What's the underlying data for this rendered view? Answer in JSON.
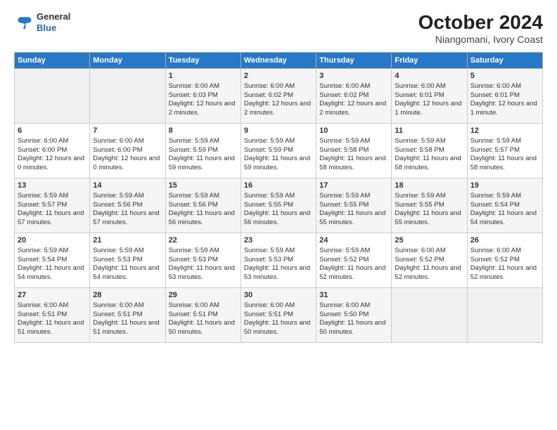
{
  "header": {
    "logo_line1": "General",
    "logo_line2": "Blue",
    "title": "October 2024",
    "subtitle": "Niangomani, Ivory Coast"
  },
  "days_of_week": [
    "Sunday",
    "Monday",
    "Tuesday",
    "Wednesday",
    "Thursday",
    "Friday",
    "Saturday"
  ],
  "weeks": [
    [
      {
        "day": "",
        "sunrise": "",
        "sunset": "",
        "daylight": ""
      },
      {
        "day": "",
        "sunrise": "",
        "sunset": "",
        "daylight": ""
      },
      {
        "day": "1",
        "sunrise": "Sunrise: 6:00 AM",
        "sunset": "Sunset: 6:03 PM",
        "daylight": "Daylight: 12 hours and 2 minutes."
      },
      {
        "day": "2",
        "sunrise": "Sunrise: 6:00 AM",
        "sunset": "Sunset: 6:02 PM",
        "daylight": "Daylight: 12 hours and 2 minutes."
      },
      {
        "day": "3",
        "sunrise": "Sunrise: 6:00 AM",
        "sunset": "Sunset: 6:02 PM",
        "daylight": "Daylight: 12 hours and 2 minutes."
      },
      {
        "day": "4",
        "sunrise": "Sunrise: 6:00 AM",
        "sunset": "Sunset: 6:01 PM",
        "daylight": "Daylight: 12 hours and 1 minute."
      },
      {
        "day": "5",
        "sunrise": "Sunrise: 6:00 AM",
        "sunset": "Sunset: 6:01 PM",
        "daylight": "Daylight: 12 hours and 1 minute."
      }
    ],
    [
      {
        "day": "6",
        "sunrise": "Sunrise: 6:00 AM",
        "sunset": "Sunset: 6:00 PM",
        "daylight": "Daylight: 12 hours and 0 minutes."
      },
      {
        "day": "7",
        "sunrise": "Sunrise: 6:00 AM",
        "sunset": "Sunset: 6:00 PM",
        "daylight": "Daylight: 12 hours and 0 minutes."
      },
      {
        "day": "8",
        "sunrise": "Sunrise: 5:59 AM",
        "sunset": "Sunset: 5:59 PM",
        "daylight": "Daylight: 11 hours and 59 minutes."
      },
      {
        "day": "9",
        "sunrise": "Sunrise: 5:59 AM",
        "sunset": "Sunset: 5:59 PM",
        "daylight": "Daylight: 11 hours and 59 minutes."
      },
      {
        "day": "10",
        "sunrise": "Sunrise: 5:59 AM",
        "sunset": "Sunset: 5:58 PM",
        "daylight": "Daylight: 11 hours and 58 minutes."
      },
      {
        "day": "11",
        "sunrise": "Sunrise: 5:59 AM",
        "sunset": "Sunset: 5:58 PM",
        "daylight": "Daylight: 11 hours and 58 minutes."
      },
      {
        "day": "12",
        "sunrise": "Sunrise: 5:59 AM",
        "sunset": "Sunset: 5:57 PM",
        "daylight": "Daylight: 11 hours and 58 minutes."
      }
    ],
    [
      {
        "day": "13",
        "sunrise": "Sunrise: 5:59 AM",
        "sunset": "Sunset: 5:57 PM",
        "daylight": "Daylight: 11 hours and 57 minutes."
      },
      {
        "day": "14",
        "sunrise": "Sunrise: 5:59 AM",
        "sunset": "Sunset: 5:56 PM",
        "daylight": "Daylight: 11 hours and 57 minutes."
      },
      {
        "day": "15",
        "sunrise": "Sunrise: 5:59 AM",
        "sunset": "Sunset: 5:56 PM",
        "daylight": "Daylight: 11 hours and 56 minutes."
      },
      {
        "day": "16",
        "sunrise": "Sunrise: 5:59 AM",
        "sunset": "Sunset: 5:55 PM",
        "daylight": "Daylight: 11 hours and 56 minutes."
      },
      {
        "day": "17",
        "sunrise": "Sunrise: 5:59 AM",
        "sunset": "Sunset: 5:55 PM",
        "daylight": "Daylight: 11 hours and 55 minutes."
      },
      {
        "day": "18",
        "sunrise": "Sunrise: 5:59 AM",
        "sunset": "Sunset: 5:55 PM",
        "daylight": "Daylight: 11 hours and 55 minutes."
      },
      {
        "day": "19",
        "sunrise": "Sunrise: 5:59 AM",
        "sunset": "Sunset: 5:54 PM",
        "daylight": "Daylight: 11 hours and 54 minutes."
      }
    ],
    [
      {
        "day": "20",
        "sunrise": "Sunrise: 5:59 AM",
        "sunset": "Sunset: 5:54 PM",
        "daylight": "Daylight: 11 hours and 54 minutes."
      },
      {
        "day": "21",
        "sunrise": "Sunrise: 5:59 AM",
        "sunset": "Sunset: 5:53 PM",
        "daylight": "Daylight: 11 hours and 54 minutes."
      },
      {
        "day": "22",
        "sunrise": "Sunrise: 5:59 AM",
        "sunset": "Sunset: 5:53 PM",
        "daylight": "Daylight: 11 hours and 53 minutes."
      },
      {
        "day": "23",
        "sunrise": "Sunrise: 5:59 AM",
        "sunset": "Sunset: 5:53 PM",
        "daylight": "Daylight: 11 hours and 53 minutes."
      },
      {
        "day": "24",
        "sunrise": "Sunrise: 5:59 AM",
        "sunset": "Sunset: 5:52 PM",
        "daylight": "Daylight: 11 hours and 52 minutes."
      },
      {
        "day": "25",
        "sunrise": "Sunrise: 6:00 AM",
        "sunset": "Sunset: 5:52 PM",
        "daylight": "Daylight: 11 hours and 52 minutes."
      },
      {
        "day": "26",
        "sunrise": "Sunrise: 6:00 AM",
        "sunset": "Sunset: 5:52 PM",
        "daylight": "Daylight: 11 hours and 52 minutes."
      }
    ],
    [
      {
        "day": "27",
        "sunrise": "Sunrise: 6:00 AM",
        "sunset": "Sunset: 5:51 PM",
        "daylight": "Daylight: 11 hours and 51 minutes."
      },
      {
        "day": "28",
        "sunrise": "Sunrise: 6:00 AM",
        "sunset": "Sunset: 5:51 PM",
        "daylight": "Daylight: 11 hours and 51 minutes."
      },
      {
        "day": "29",
        "sunrise": "Sunrise: 6:00 AM",
        "sunset": "Sunset: 5:51 PM",
        "daylight": "Daylight: 11 hours and 50 minutes."
      },
      {
        "day": "30",
        "sunrise": "Sunrise: 6:00 AM",
        "sunset": "Sunset: 5:51 PM",
        "daylight": "Daylight: 11 hours and 50 minutes."
      },
      {
        "day": "31",
        "sunrise": "Sunrise: 6:00 AM",
        "sunset": "Sunset: 5:50 PM",
        "daylight": "Daylight: 11 hours and 50 minutes."
      },
      {
        "day": "",
        "sunrise": "",
        "sunset": "",
        "daylight": ""
      },
      {
        "day": "",
        "sunrise": "",
        "sunset": "",
        "daylight": ""
      }
    ]
  ]
}
